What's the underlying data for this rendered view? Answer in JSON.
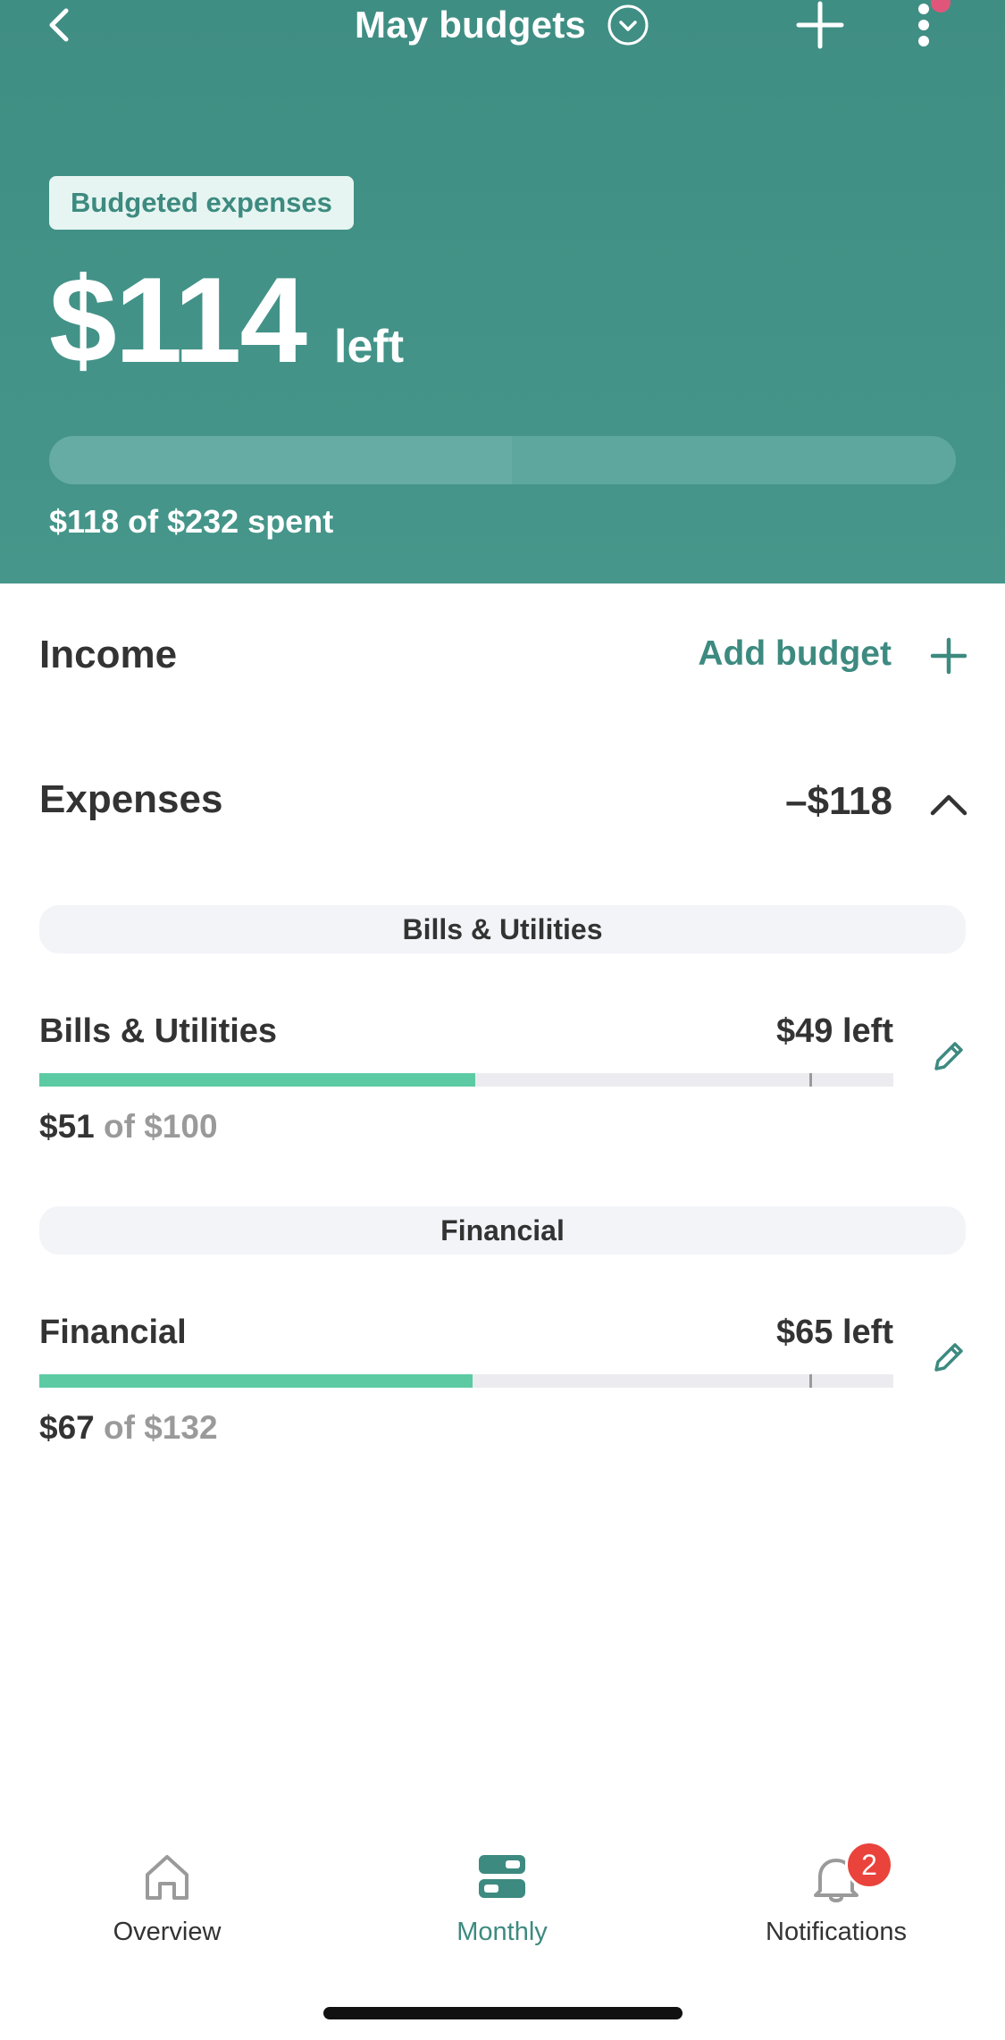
{
  "header": {
    "title": "May budgets",
    "badge": "Budgeted expenses",
    "amount_left": "$114",
    "amount_suffix": "left",
    "spent_text": "$118 of $232 spent",
    "spent_fraction": 0.51
  },
  "income": {
    "title": "Income",
    "add_budget_label": "Add budget"
  },
  "expenses": {
    "title": "Expenses",
    "total": "–$118",
    "groups": [
      {
        "group_label": "Bills & Utilities",
        "name": "Bills & Utilities",
        "left": "$49 left",
        "spent": "$51",
        "of_text": "of $100",
        "fraction": 0.51
      },
      {
        "group_label": "Financial",
        "name": "Financial",
        "left": "$65 left",
        "spent": "$67",
        "of_text": "of $132",
        "fraction": 0.5076
      }
    ]
  },
  "nav": {
    "overview": "Overview",
    "monthly": "Monthly",
    "notifications": "Notifications",
    "notifications_count": "2"
  },
  "colors": {
    "header_bg": "#44948a",
    "accent": "#3d8a80",
    "progress_fill": "#5ccba4",
    "badge_red": "#e9433c",
    "notif_dot": "#e0567a"
  },
  "icons": {
    "back": "chevron-left-icon",
    "dropdown": "chevron-down-circle-icon",
    "add": "plus-icon",
    "more": "more-vertical-icon",
    "collapse": "chevron-up-icon",
    "edit": "pencil-icon",
    "overview": "home-icon",
    "monthly": "budget-stack-icon",
    "notifications": "bell-icon"
  }
}
